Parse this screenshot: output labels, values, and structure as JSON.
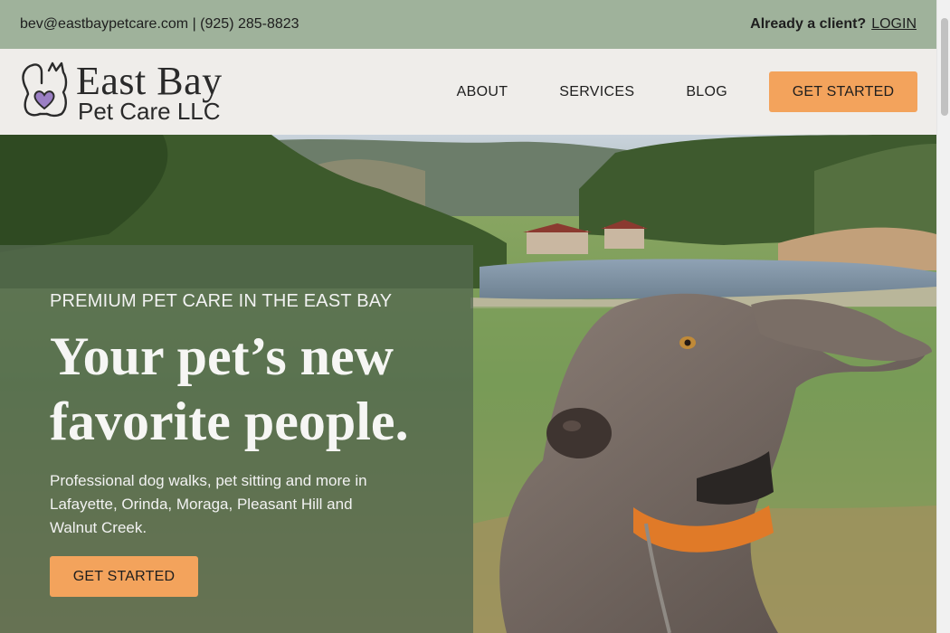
{
  "topbar": {
    "contact": "bev@eastbaypetcare.com | (925) 285-8823",
    "client_question": "Already a client?",
    "login": "LOGIN"
  },
  "header": {
    "logo_name": "East Bay",
    "logo_sub": "Pet Care LLC",
    "logo_icon": "dog-cat-heart-icon",
    "nav": [
      "ABOUT",
      "SERVICES",
      "BLOG"
    ],
    "cta": "GET STARTED"
  },
  "hero": {
    "eyebrow": "PREMIUM PET CARE IN THE EAST BAY",
    "headline": "Your pet’s new favorite people.",
    "description": "Professional dog walks, pet sitting and more in Lafayette, Orinda, Moraga, Pleasant Hill and Walnut Creek.",
    "cta": "GET STARTED",
    "image": "weimaraner-dog-by-lake-photo"
  },
  "colors": {
    "topbar_bg": "#9fb29b",
    "header_bg": "#efedea",
    "accent": "#f3a35c",
    "panel_bg": "#546950"
  }
}
